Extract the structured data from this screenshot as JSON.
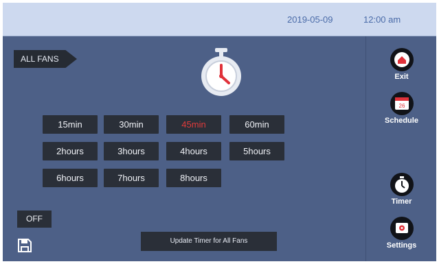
{
  "header": {
    "date": "2019-05-09",
    "time": "12:00 am"
  },
  "main": {
    "group_label": "ALL FANS",
    "timer_options": [
      {
        "label": "15min",
        "selected": false
      },
      {
        "label": "30min",
        "selected": false
      },
      {
        "label": "45min",
        "selected": true
      },
      {
        "label": "60min",
        "selected": false
      },
      {
        "label": "2hours",
        "selected": false
      },
      {
        "label": "3hours",
        "selected": false
      },
      {
        "label": "4hours",
        "selected": false
      },
      {
        "label": "5hours",
        "selected": false
      },
      {
        "label": "6hours",
        "selected": false
      },
      {
        "label": "7hours",
        "selected": false
      },
      {
        "label": "8hours",
        "selected": false
      }
    ],
    "off_label": "OFF",
    "update_label": "Update Timer for All Fans",
    "timer_icon": "stopwatch-icon",
    "save_icon": "save-icon"
  },
  "sidebar": {
    "items": [
      {
        "label": "Exit",
        "icon": "home-icon"
      },
      {
        "label": "Schedule",
        "icon": "calendar-icon",
        "icon_text": "26"
      },
      {
        "label": "Timer",
        "icon": "stopwatch-icon"
      },
      {
        "label": "Settings",
        "icon": "gear-icon"
      }
    ]
  },
  "colors": {
    "background": "#4d6087",
    "topbar": "#cdd9ef",
    "button": "#2a2f38",
    "selected_text": "#e23b3b",
    "icon_accent": "#e0323a"
  }
}
